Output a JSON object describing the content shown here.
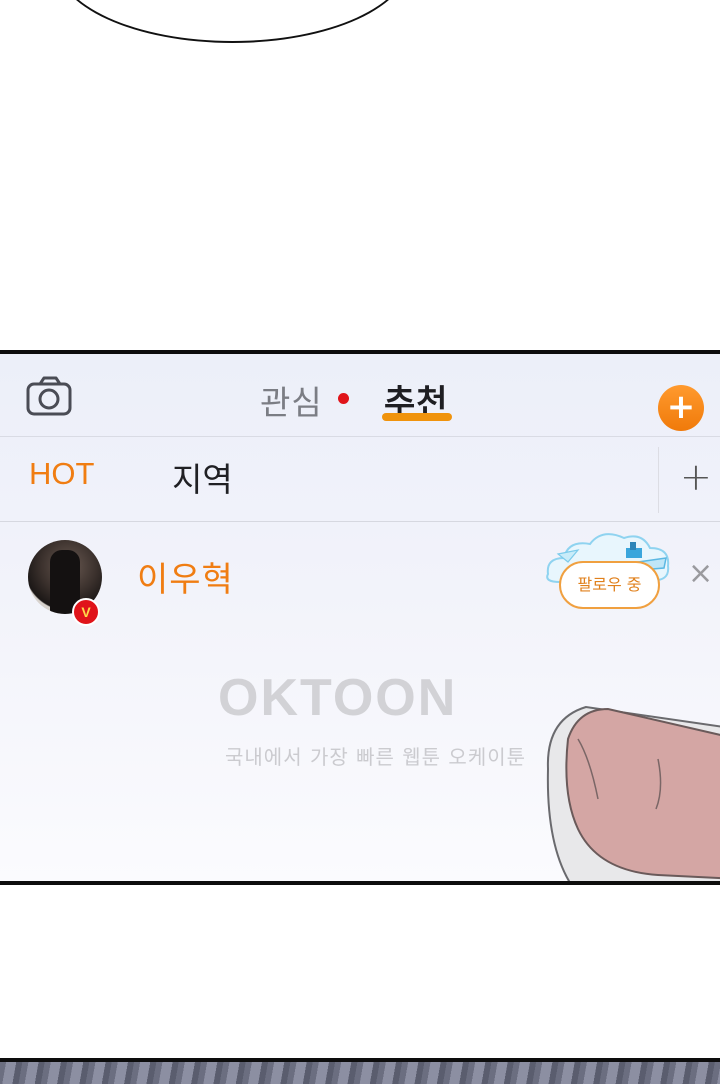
{
  "header": {
    "tab_interest": "관심",
    "tab_recommend": "추천",
    "add_symbol": "+"
  },
  "subtabs": {
    "hot": "HOT",
    "region": "지역",
    "plus_symbol": "+"
  },
  "profile": {
    "username": "이우혁",
    "badge": "V",
    "follow_label": "팔로우 중",
    "close_symbol": "×"
  },
  "watermark": {
    "logo": "OKTOON",
    "tagline": "국내에서 가장 빠른 웹툰 오케이툰"
  },
  "colors": {
    "accent": "#f07d12",
    "badge_red": "#e0141a"
  },
  "icons": [
    "camera-icon",
    "add-icon",
    "plus-icon",
    "verified-icon",
    "close-icon"
  ]
}
